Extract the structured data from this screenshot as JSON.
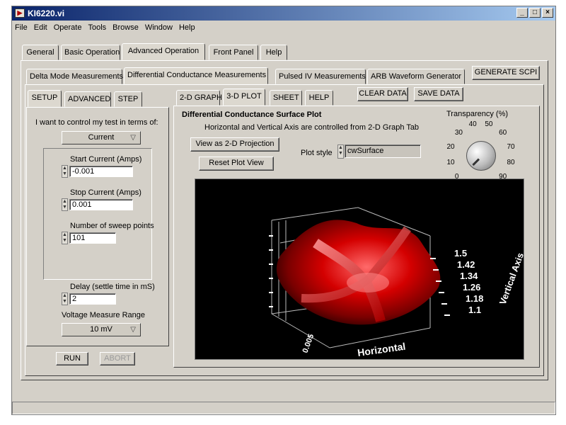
{
  "window": {
    "title": "KI6220.vi"
  },
  "menu": [
    "File",
    "Edit",
    "Operate",
    "Tools",
    "Browse",
    "Window",
    "Help"
  ],
  "main_tabs": [
    "General",
    "Basic Operation",
    "Advanced Operation",
    "Front Panel",
    "Help"
  ],
  "sub_tabs": [
    "Delta Mode Measurements",
    "Differential Conductance Measurements",
    "Pulsed IV Measurements",
    "ARB Waveform Generator"
  ],
  "generate_button": "GENERATE SCPI",
  "left_tabs": [
    "SETUP",
    "ADVANCED",
    "STEP"
  ],
  "setup": {
    "control_label": "I want to control my test in terms of:",
    "control_value": "Current",
    "start_label": "Start Current (Amps)",
    "start_value": "-0.001",
    "stop_label": "Stop Current (Amps)",
    "stop_value": "0.001",
    "points_label": "Number of sweep points",
    "points_value": "101",
    "delay_label": "Delay (settle time in mS)",
    "delay_value": "2",
    "range_label": "Voltage Measure Range",
    "range_value": "10 mV"
  },
  "run_button": "RUN",
  "abort_button": "ABORT",
  "right_tabs": [
    "2-D GRAPH",
    "3-D PLOT",
    "SHEET",
    "HELP"
  ],
  "clear_button": "CLEAR DATA",
  "save_button": "SAVE DATA",
  "plot_section": {
    "title": "Differential Conductance Surface Plot",
    "subtitle": "Horizontal and Vertical Axis are controlled from 2-D Graph Tab",
    "projection_button": "View as 2-D Projection",
    "reset_button": "Reset Plot View",
    "style_label": "Plot style",
    "style_value": "cwSurface"
  },
  "transparency": {
    "label": "Transparency (%)",
    "ticks": [
      "0",
      "10",
      "20",
      "30",
      "40",
      "50",
      "60",
      "70",
      "80",
      "90"
    ],
    "value": 0
  },
  "plot3d": {
    "right_ticks": [
      "1.5",
      "1.42",
      "1.34",
      "1.26",
      "1.18",
      "1.1"
    ],
    "axis_title_right": "Vertical Axis",
    "axis_title_bottom": "Horizontal",
    "bottom_tick": "0.005"
  },
  "colors": {
    "surface": "#cc0000",
    "plot_bg": "#000000",
    "title_left": "#0a246a",
    "title_right": "#a6caf0"
  }
}
